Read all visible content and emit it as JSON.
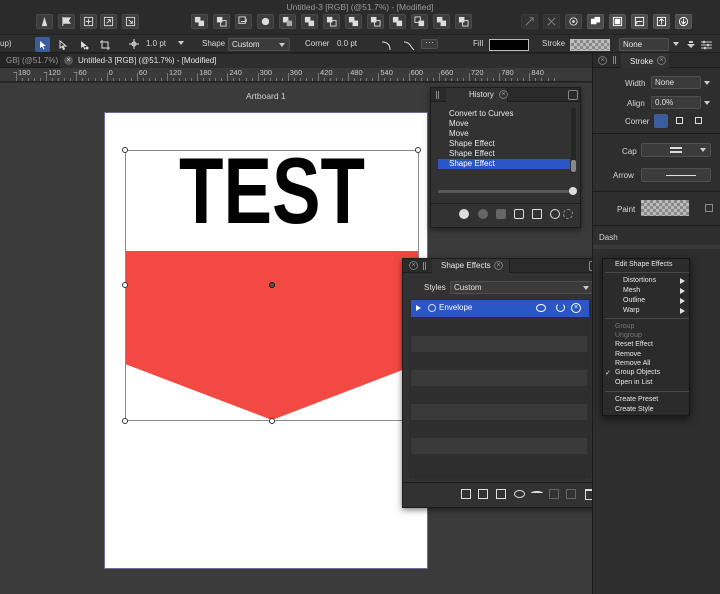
{
  "window": {
    "title": "Untitled-3 [RGB] (@51.7%) - [Modified]"
  },
  "context_toolbar": {
    "group_label": "up)",
    "stroke_width": "1.0 pt",
    "shape_label": "Shape",
    "shape_value": "Custom",
    "corner_label": "Corner",
    "corner_value": "0.0 pt",
    "fill_label": "Fill",
    "stroke_label": "Stroke",
    "stroke_style_value": "None",
    "fill_color": "#000000"
  },
  "tabs": {
    "left": "GB] (@51.7%) - [M",
    "active": "Untitled-3 [RGB] (@51.7%) - [Modified]"
  },
  "ruler": {
    "ticks": [
      "180",
      "120",
      "60",
      "0",
      "60",
      "120",
      "180",
      "240",
      "300",
      "360",
      "420",
      "480",
      "540",
      "600",
      "660",
      "720",
      "780",
      "840"
    ],
    "minus": "−"
  },
  "canvas": {
    "artboard_label": "Artboard 1",
    "text_object": "TEST",
    "shape_color": "#f24a42"
  },
  "history_panel": {
    "title": "History",
    "items": [
      "Convert to Curves",
      "Move",
      "Move",
      "Shape Effect",
      "Shape Effect",
      "Shape Effect"
    ],
    "active_index": 5
  },
  "shape_effects_panel": {
    "title": "Shape Effects",
    "styles_label": "Styles",
    "styles_value": "Custom",
    "effect_name": "Envelope"
  },
  "stroke_panel": {
    "tab": "Stroke",
    "width_label": "Width",
    "width_value": "None",
    "align_label": "Align",
    "align_value": "0.0%",
    "corner_label": "Corner",
    "cap_label": "Cap",
    "arrow_label": "Arrow",
    "paint_label": "Paint",
    "dash_label": "Dash"
  },
  "context_menu": {
    "header": "Edit Shape Effects",
    "items": [
      "Distortions",
      "Mesh",
      "Outline",
      "Warp",
      "Group",
      "Ungroup",
      "Reset Effect",
      "Remove",
      "Remove All",
      "Group Objects",
      "Open in List",
      "Create Preset",
      "Create Style"
    ],
    "check_mark": "✓"
  }
}
